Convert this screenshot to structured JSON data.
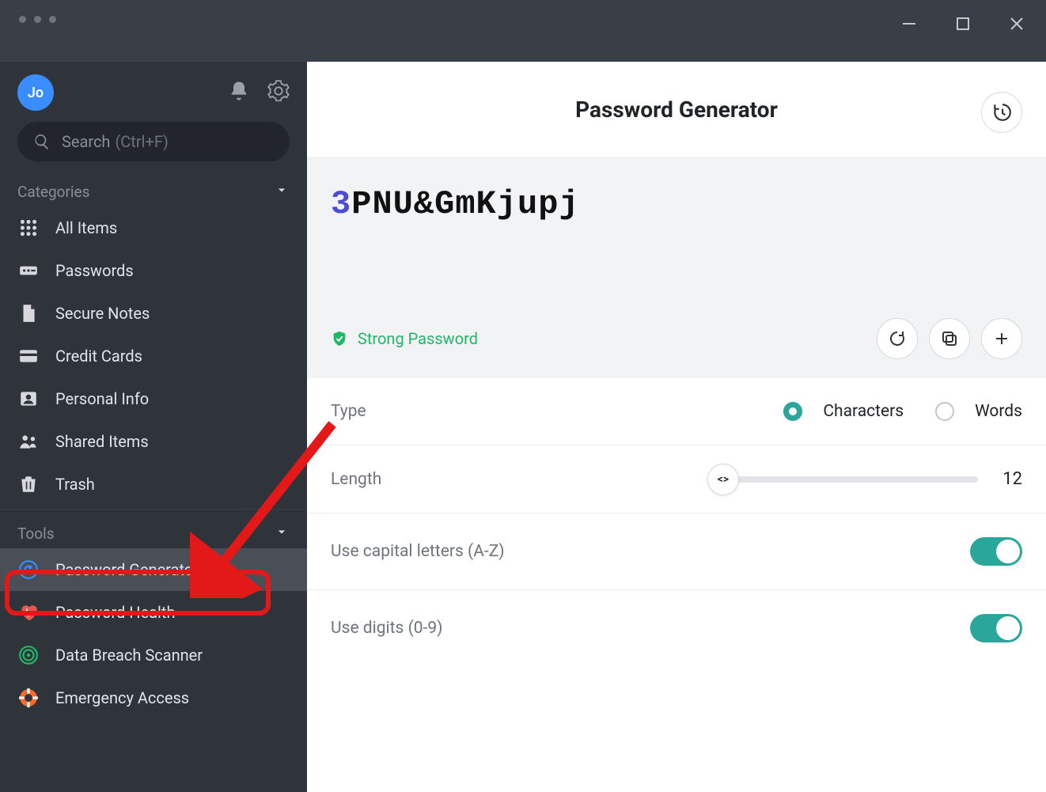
{
  "window": {
    "avatar_initials": "Jo"
  },
  "search": {
    "label": "Search",
    "hint": "(Ctrl+F)"
  },
  "categories": {
    "header": "Categories",
    "items": [
      {
        "label": "All Items"
      },
      {
        "label": "Passwords"
      },
      {
        "label": "Secure Notes"
      },
      {
        "label": "Credit Cards"
      },
      {
        "label": "Personal Info"
      },
      {
        "label": "Shared Items"
      },
      {
        "label": "Trash"
      }
    ]
  },
  "tools": {
    "header": "Tools",
    "items": [
      {
        "label": "Password Generator",
        "active": true
      },
      {
        "label": "Password Health"
      },
      {
        "label": "Data Breach Scanner"
      },
      {
        "label": "Emergency Access"
      }
    ]
  },
  "main": {
    "title": "Password Generator",
    "generated_password": "3PNU&GmKjupj",
    "strength_label": "Strong Password",
    "settings": {
      "type": {
        "label": "Type",
        "options": [
          "Characters",
          "Words"
        ],
        "selected": "Characters"
      },
      "length": {
        "label": "Length",
        "value": 12
      },
      "use_capitals": {
        "label": "Use capital letters (A-Z)",
        "enabled": true
      },
      "use_digits": {
        "label": "Use digits (0-9)",
        "enabled": true
      }
    }
  },
  "annotation": {
    "highlighted_sidebar_item": "Password Generator"
  }
}
